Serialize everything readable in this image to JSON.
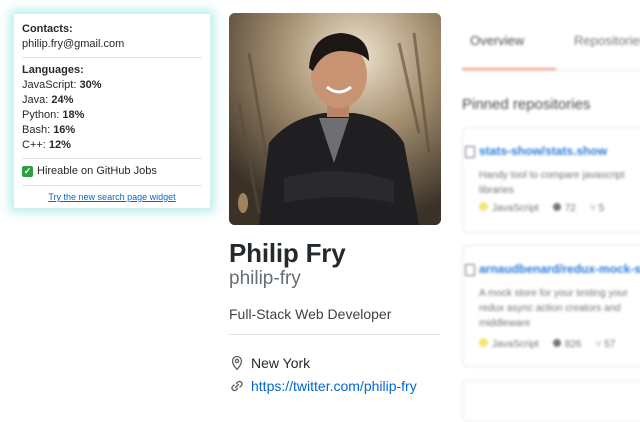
{
  "popup": {
    "contacts_heading": "Contacts:",
    "email": "philip.fry@gmail.com",
    "languages_heading": "Languages:",
    "languages": [
      {
        "name": "JavaScript: ",
        "percent": "30%"
      },
      {
        "name": "Java: ",
        "percent": "24%"
      },
      {
        "name": "Python: ",
        "percent": "18%"
      },
      {
        "name": "Bash: ",
        "percent": "16%"
      },
      {
        "name": "C++: ",
        "percent": "12%"
      }
    ],
    "hireable_text": "Hireable on GitHub Jobs",
    "widget_link": "Try the new search page widget",
    "accent_color": "#55d6d6"
  },
  "profile": {
    "name": "Philip Fry",
    "login": "philip-fry",
    "bio": "Full-Stack Web Developer",
    "location": "New York",
    "website": "https://twitter.com/philip-fry",
    "location_icon": "location-pin-icon",
    "link_icon": "link-icon"
  },
  "tabs": {
    "overview": "Overview",
    "repositories": "Repositories",
    "active_color": "#f9826c"
  },
  "pinned": {
    "title": "Pinned repositories",
    "repos": [
      {
        "link": "stats-show/stats.show",
        "description": "Handy tool to compare javascript libraries",
        "language": "JavaScript",
        "stars": "72",
        "forks": "5"
      },
      {
        "link": "arnaudbenard/redux-mock-store",
        "description": "A mock store for your testing your redux async action creators and middleware",
        "language": "JavaScript",
        "stars": "826",
        "forks": "57"
      }
    ],
    "language_color": "#f1e05a"
  }
}
